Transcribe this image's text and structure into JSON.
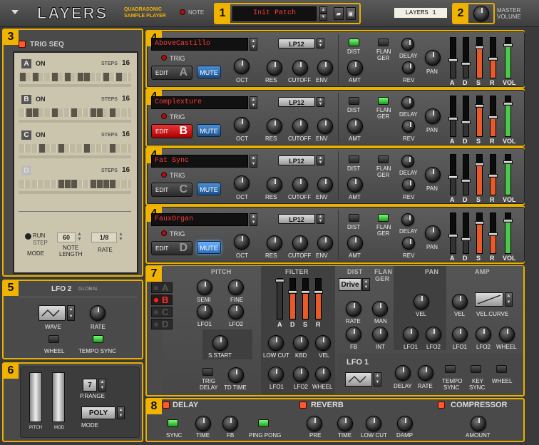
{
  "header": {
    "logo": "LAYERS",
    "subtitle1": "QUADRASONIC",
    "subtitle2": "SAMPLE PLAYER",
    "note_label": "NOTE",
    "patch_name": "Init Patch",
    "display_name": "LAYERS 1",
    "master_label": "MASTER",
    "volume_label": "VOLUME"
  },
  "callouts": [
    "1",
    "2",
    "3",
    "4",
    "4",
    "4",
    "4",
    "5",
    "6",
    "7",
    "8"
  ],
  "trigseq": {
    "title": "TRIG SEQ",
    "lanes": [
      {
        "letter": "A",
        "state": "ON",
        "steps_label": "STEPS",
        "steps": "16",
        "pattern": [
          1,
          0,
          1,
          0,
          0,
          1,
          0,
          1,
          0,
          1,
          1,
          0,
          0,
          1,
          0,
          1
        ]
      },
      {
        "letter": "B",
        "state": "ON",
        "steps_label": "STEPS",
        "steps": "16",
        "pattern": [
          0,
          1,
          1,
          0,
          0,
          1,
          0,
          0,
          1,
          0,
          0,
          1,
          1,
          0,
          1,
          0
        ]
      },
      {
        "letter": "C",
        "state": "ON",
        "steps_label": "STEPS",
        "steps": "16",
        "pattern": [
          0,
          0,
          0,
          1,
          0,
          0,
          1,
          0,
          0,
          0,
          1,
          0,
          0,
          0,
          1,
          0
        ]
      },
      {
        "letter": "D",
        "state": "",
        "steps_label": "STEPS",
        "steps": "16",
        "pattern": [
          0,
          0,
          0,
          0,
          0,
          0,
          1,
          1,
          1,
          0,
          0,
          1,
          1,
          1,
          1,
          0
        ]
      }
    ],
    "run_label": "RUN",
    "step_label": "STEP",
    "mode_label": "MODE",
    "note_length": "60",
    "note_length_label1": "NOTE",
    "note_length_label2": "LENGTH",
    "rate": "1/8",
    "rate_label": "RATE"
  },
  "layers": [
    {
      "letter": "A",
      "patch": "AboveCastillo",
      "trig": "TRIG",
      "edit": "EDIT",
      "mute": "MUTE",
      "filter": "LP12",
      "dist_on": true,
      "flanger_on": false,
      "selected": false,
      "mute_on": false
    },
    {
      "letter": "B",
      "patch": "Complexture",
      "trig": "TRIG",
      "edit": "EDIT",
      "mute": "MUTE",
      "filter": "LP12",
      "dist_on": false,
      "flanger_on": true,
      "selected": true,
      "mute_on": false
    },
    {
      "letter": "C",
      "patch": "Fat Sync",
      "trig": "TRIG",
      "edit": "EDIT",
      "mute": "MUTE",
      "filter": "LP12",
      "dist_on": false,
      "flanger_on": false,
      "selected": false,
      "mute_on": false
    },
    {
      "letter": "D",
      "patch": "FauxOrgan",
      "trig": "TRIG",
      "edit": "EDIT",
      "mute": "MUTE",
      "filter": "LP12",
      "dist_on": false,
      "flanger_on": true,
      "selected": false,
      "mute_on": true
    }
  ],
  "layer_labels": {
    "oct": "OCT",
    "res": "RES",
    "cutoff": "CUTOFF",
    "env": "ENV",
    "dist": "DIST",
    "amt": "AMT",
    "flan": "FLAN",
    "ger": "GER",
    "delay": "DELAY",
    "rev": "REV",
    "pan": "PAN",
    "a": "A",
    "d": "D",
    "s": "S",
    "r": "R",
    "vol": "VOL"
  },
  "lfo2": {
    "title": "LFO 2",
    "scope": "GLOBAL",
    "wave": "WAVE",
    "rate": "RATE",
    "wheel": "WHEEL",
    "tempo_sync": "TEMPO SYNC"
  },
  "perf": {
    "pitch": "PITCH",
    "mod": "MOD",
    "prange_value": "7",
    "prange": "P.RANGE",
    "mode_value": "POLY",
    "mode": "MODE"
  },
  "edit_panel": {
    "tabs": [
      "A",
      "B",
      "C",
      "D"
    ],
    "active": "B",
    "pitch": "PITCH",
    "semi": "SEMI",
    "fine": "FINE",
    "lfo1": "LFO1",
    "lfo2": "LFO2",
    "sstart": "S.START",
    "trig1": "TRIG",
    "trig2": "DELAY",
    "td_time": "TD TIME",
    "filter": "FILTER",
    "a": "A",
    "d": "D",
    "s": "S",
    "r": "R",
    "low_cut": "LOW CUT",
    "kbd": "KBD",
    "vel": "VEL",
    "wheel": "WHEEL",
    "dist": "DIST",
    "drive": "Drive",
    "rate": "RATE",
    "man": "MAN",
    "fb": "FB",
    "int": "INT",
    "flan": "FLAN",
    "ger": "GER",
    "pan": "PAN",
    "amp": "AMP",
    "vel_curve": "VEL.CURVE",
    "lfo1_title": "LFO 1",
    "delay": "DELAY",
    "tempo1": "TEMPO",
    "tempo2": "SYNC",
    "key1": "KEY",
    "key2": "SYNC"
  },
  "fx": {
    "delay": "DELAY",
    "reverb": "REVERB",
    "compressor": "COMPRESSOR",
    "sync": "SYNC",
    "time": "TIME",
    "fb": "FB",
    "ping_pong": "PING PONG",
    "pre": "PRE",
    "time2": "TIME",
    "low_cut": "LOW CUT",
    "damp": "DAMP",
    "amount": "AMOUNT"
  }
}
